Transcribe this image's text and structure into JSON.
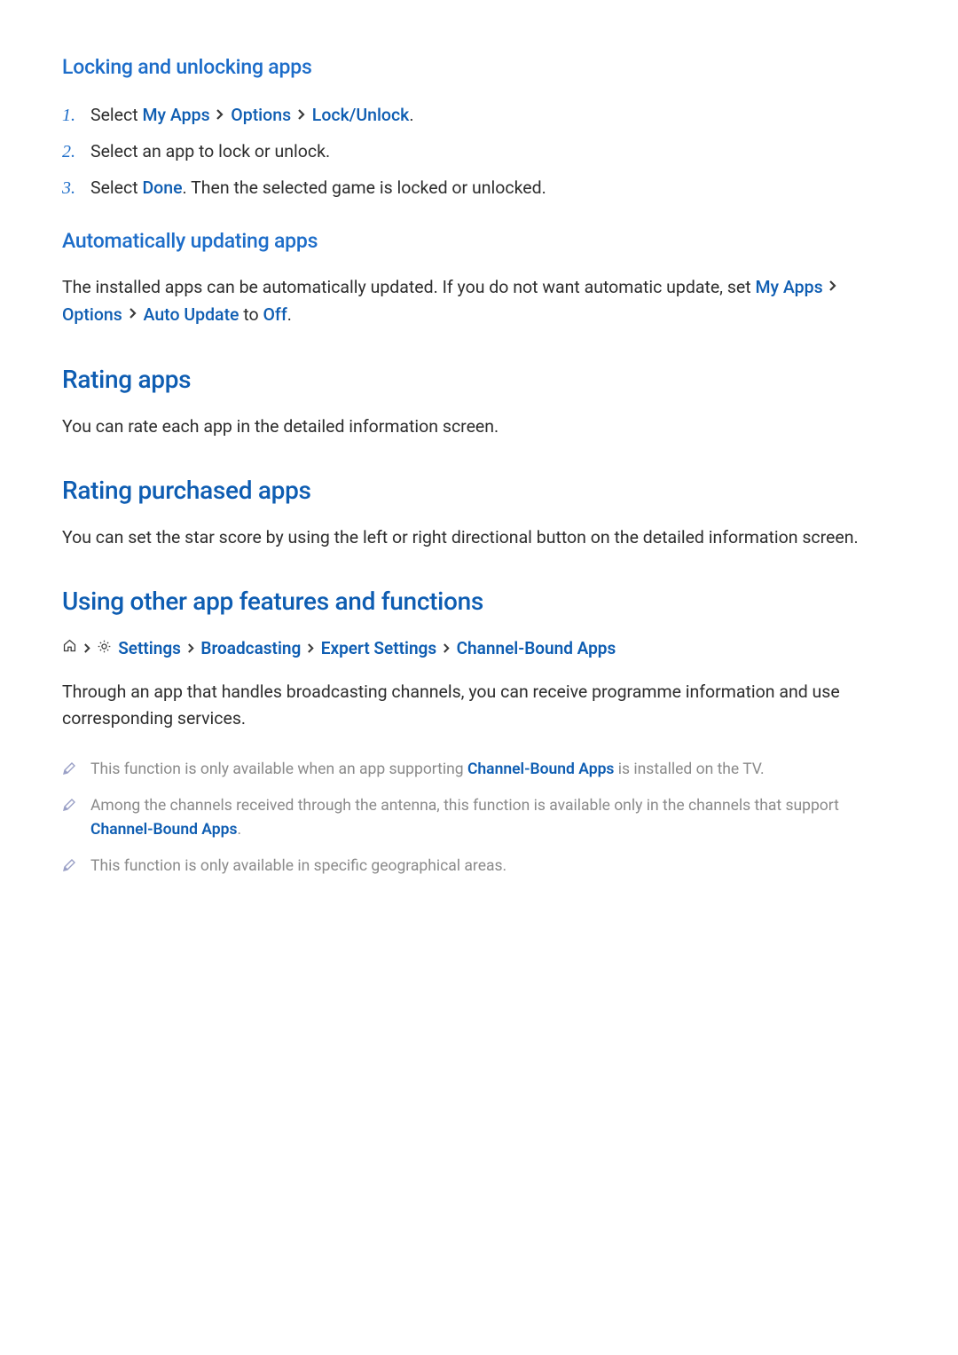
{
  "s1": {
    "heading": "Locking and unlocking apps",
    "steps": [
      {
        "num": "1.",
        "pre": "Select ",
        "link1": "My Apps",
        "link2": "Options",
        "link3": "Lock/Unlock",
        "post": "."
      },
      {
        "num": "2.",
        "text": "Select an app to lock or unlock."
      },
      {
        "num": "3.",
        "pre": "Select ",
        "link1": "Done",
        "post": ". Then the selected game is locked or unlocked."
      }
    ]
  },
  "s2": {
    "heading": "Automatically updating apps",
    "body_pre": "The installed apps can be automatically updated. If you do not want automatic update, set ",
    "link1": "My Apps",
    "link2": "Options",
    "link3": "Auto Update",
    "body_mid": " to ",
    "link4": "Off",
    "body_post": "."
  },
  "s3": {
    "heading": "Rating apps",
    "body": "You can rate each app in the detailed information screen."
  },
  "s4": {
    "heading": "Rating purchased apps",
    "body": "You can set the star score by using the left or right directional button on the detailed information screen."
  },
  "s5": {
    "heading": "Using other app features and functions",
    "bc": {
      "settings": "Settings",
      "broadcasting": "Broadcasting",
      "expert": "Expert Settings",
      "cba": "Channel-Bound Apps"
    },
    "body": "Through an app that handles broadcasting channels, you can receive programme information and use corresponding services.",
    "notes": [
      {
        "pre": "This function is only available when an app supporting ",
        "link": "Channel-Bound Apps",
        "post": " is installed on the TV."
      },
      {
        "pre": "Among the channels received through the antenna, this function is available only in the channels that support ",
        "link": "Channel-Bound Apps",
        "post": "."
      },
      {
        "text": "This function is only available in specific geographical areas."
      }
    ]
  }
}
